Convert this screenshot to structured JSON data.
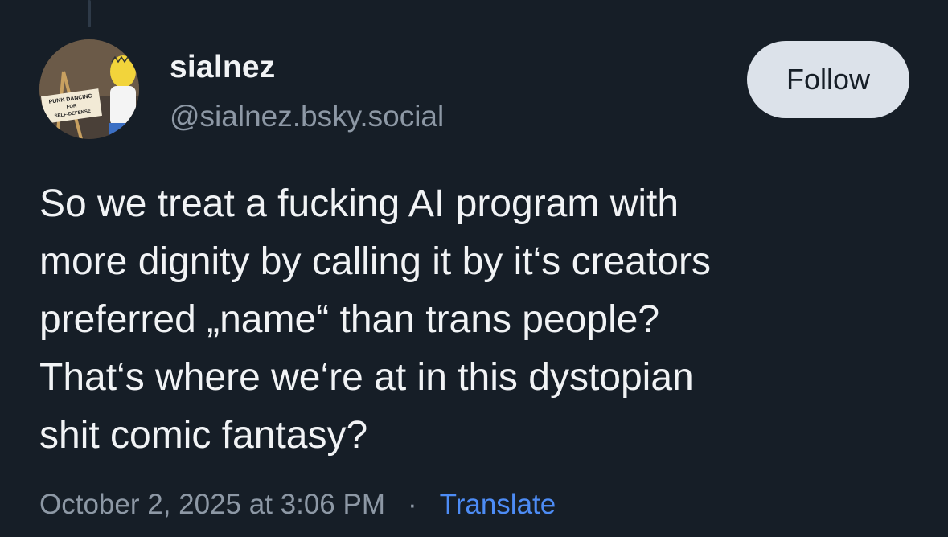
{
  "author": {
    "display_name": "sialnez",
    "handle": "@sialnez.bsky.social",
    "avatar_sign_text": [
      "PUNK DANCING",
      "FOR",
      "SELF-DEFENSE"
    ]
  },
  "follow_button": {
    "label": "Follow"
  },
  "post": {
    "lines": [
      "So we treat a fucking AI program with",
      "more dignity by calling it by it‘s creators",
      "preferred „name“ than trans people?",
      "That‘s where we‘re at in this dystopian",
      "shit comic fantasy?"
    ]
  },
  "meta": {
    "timestamp": "October 2, 2025 at 3:06 PM",
    "separator": "·",
    "translate_label": "Translate"
  },
  "colors": {
    "background": "#161e27",
    "text": "#f1f3f5",
    "muted": "#8d98a5",
    "link": "#4d8cf5",
    "button_bg": "#dce2ea"
  }
}
